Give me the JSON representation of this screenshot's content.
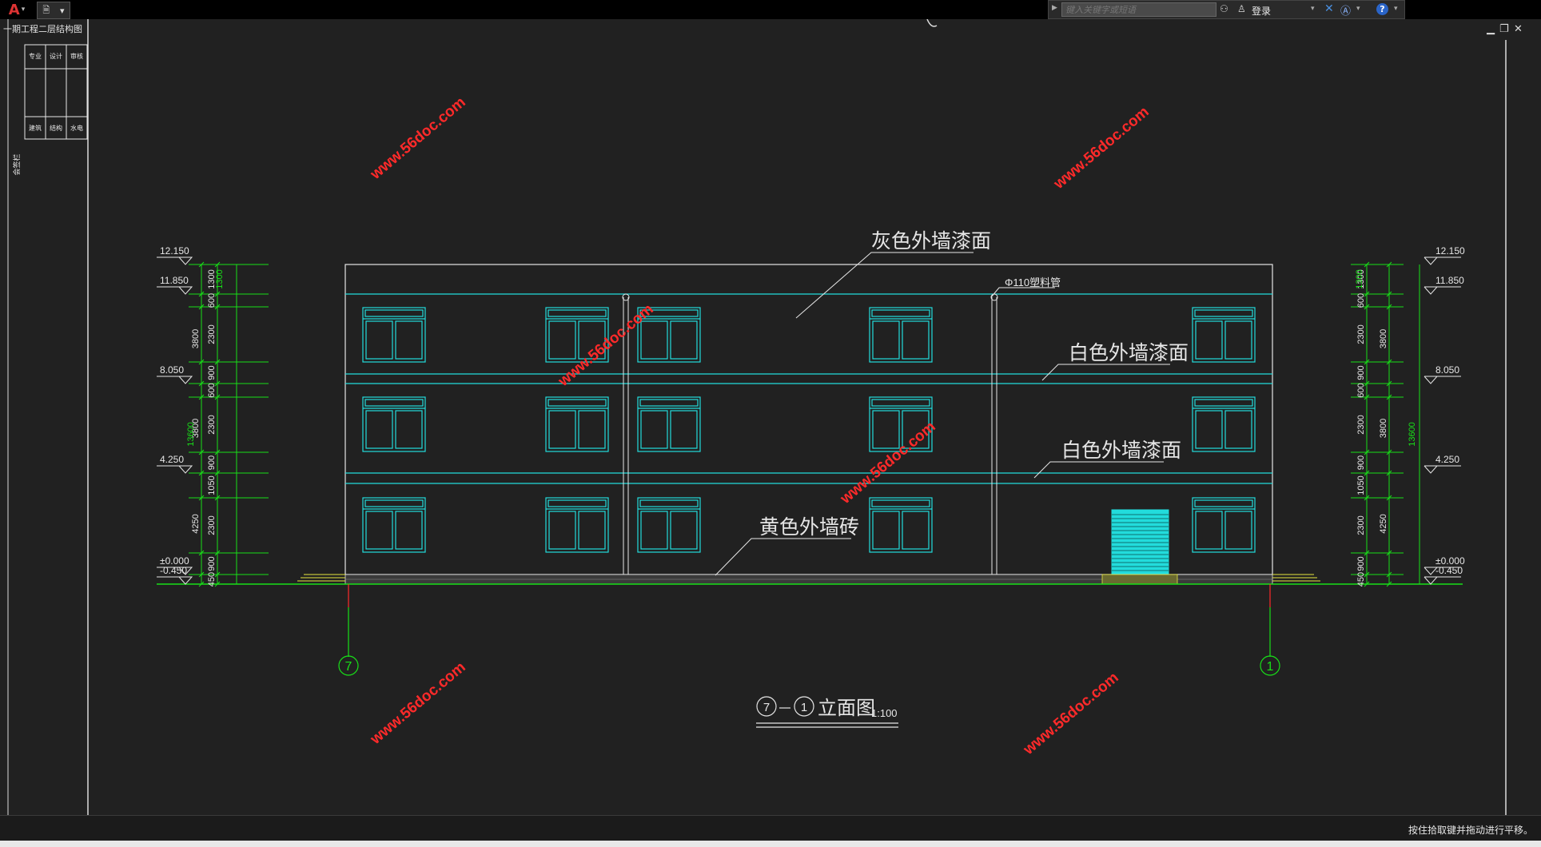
{
  "window": {
    "doc_title": "一期工程二层结构图",
    "search_placeholder": "键入关键字或短语",
    "login_label": "登录",
    "app_icon": "autocad-icon",
    "colors": {
      "background": "#212121",
      "cyan": "#22dcdc",
      "green": "#18e018",
      "red": "#ff2a2a",
      "white": "#e6e6e6"
    }
  },
  "titleblock": {
    "row1": [
      "专业",
      "设计",
      "审核"
    ],
    "row2": [
      "建筑",
      "结构",
      "水电"
    ],
    "side_label": "会签栏"
  },
  "drawing": {
    "notes": [
      "灰色外墙漆面",
      "白色外墙漆面",
      "白色外墙漆面",
      "黄色外墙砖"
    ],
    "pipe_label": "Φ110塑料管",
    "title": "立面图",
    "axis_left": "7",
    "axis_right": "1",
    "scale": "1:100",
    "elev_left": [
      "12.150",
      "11.850",
      "8.050",
      "4.250",
      "±0.000",
      "-0.450"
    ],
    "elev_right": [
      "12.150",
      "11.850",
      "8.050",
      "4.250",
      "±0.000",
      "-0.450"
    ],
    "dims_inner": [
      "1300",
      "600",
      "2300",
      "900",
      "600",
      "2300",
      "900",
      "1050",
      "2300",
      "900",
      "450"
    ],
    "dims_outer": [
      "3800",
      "3800",
      "4250"
    ],
    "dim_total": "13600",
    "watermarks": [
      "www.56doc.com",
      "www.56doc.com",
      "www.56doc.com",
      "www.56doc.com",
      "www.56doc.com",
      "www.56doc.com"
    ]
  },
  "status": {
    "message": "按住拾取键并拖动进行平移。"
  }
}
